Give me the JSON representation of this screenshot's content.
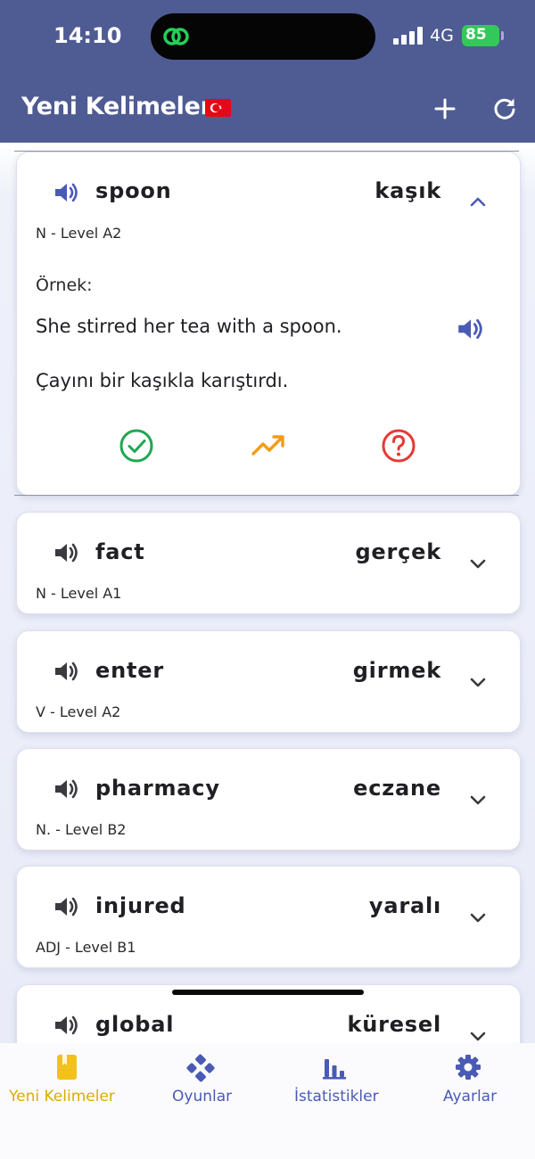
{
  "status_bar": {
    "time": "14:10",
    "network": "4G",
    "battery": "85"
  },
  "header": {
    "title": "Yeni Kelimeler",
    "flag_icon": "turkey-flag-icon",
    "actions": [
      "plus-icon",
      "refresh-icon"
    ]
  },
  "expanded_card": {
    "word": "spoon",
    "translation": "kaşık",
    "level": "N - Level A2",
    "example_label": "Örnek:",
    "example_en": "She stirred her tea with a spoon.",
    "example_tr": "Çayını bir kaşıkla karıştırdı.",
    "actions": [
      "check-circle-icon",
      "trending-up-icon",
      "question-circle-icon"
    ]
  },
  "cards": [
    {
      "word": "fact",
      "translation": "gerçek",
      "level": "N - Level A1"
    },
    {
      "word": "enter",
      "translation": "girmek",
      "level": "V - Level A2"
    },
    {
      "word": "pharmacy",
      "translation": "eczane",
      "level": "N. - Level B2"
    },
    {
      "word": "injured",
      "translation": "yaralı",
      "level": "ADJ - Level B1"
    },
    {
      "word": "global",
      "translation": "küresel",
      "level": ""
    }
  ],
  "nav": [
    {
      "label": "Yeni Kelimeler",
      "icon": "book-icon",
      "active": true
    },
    {
      "label": "Oyunlar",
      "icon": "gamepad-icon",
      "active": false
    },
    {
      "label": "İstatistikler",
      "icon": "bar-chart-icon",
      "active": false
    },
    {
      "label": "Ayarlar",
      "icon": "gear-icon",
      "active": false
    }
  ],
  "colors": {
    "header": "#4f5b93",
    "accent": "#4a5bb5",
    "active_nav": "#f2c21b",
    "check": "#1ea851",
    "trend": "#f39c12",
    "question": "#e53935"
  }
}
